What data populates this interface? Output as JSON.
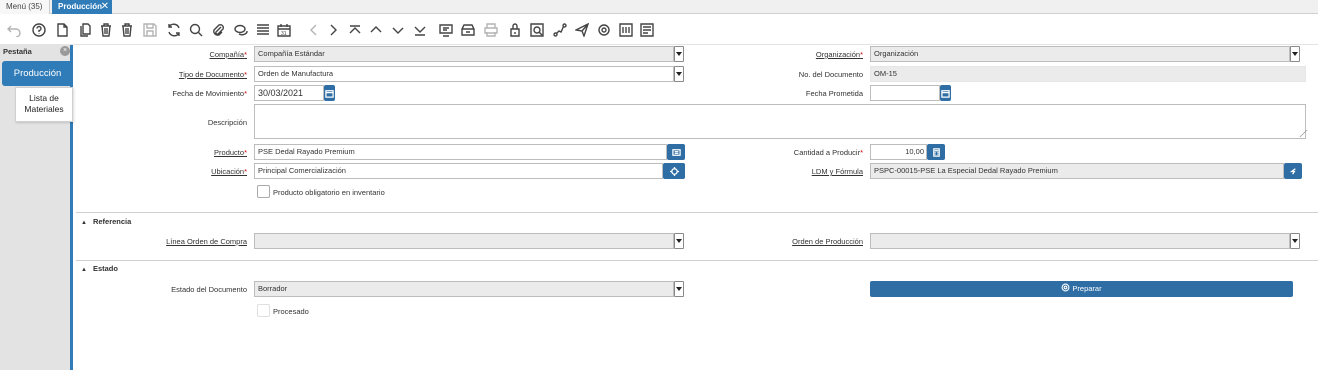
{
  "window_tabs": {
    "menu": "Menú (35)",
    "active": "Producción",
    "close": "✕"
  },
  "left_panel": {
    "title": "Pestaña",
    "items": [
      "Producción",
      "Lista de Materiales"
    ]
  },
  "toolbar_icons": [
    "undo-icon",
    "help-icon",
    "new-record-icon",
    "copy-record-icon",
    "delete-icon",
    "delete-selection-icon",
    "save-icon",
    "refresh-icon",
    "find-icon",
    "attachment-icon",
    "chat-icon",
    "grid-toggle-icon",
    "calendar-icon",
    "previous-record-icon",
    "next-record-icon",
    "first-record-icon",
    "parent-record-icon",
    "detail-record-icon",
    "last-record-icon",
    "report-icon",
    "archive-icon",
    "print-icon",
    "lock-icon",
    "zoom-across-icon",
    "workflow-icon",
    "process-icon",
    "settings-icon",
    "translate-icon",
    "post-icon"
  ],
  "form": {
    "compania": {
      "label": "Compañía",
      "value": "Compañía Estándar"
    },
    "organizacion": {
      "label": "Organización",
      "value": "Organización"
    },
    "tipo_documento": {
      "label": "Tipo de Documento",
      "value": "Orden de Manufactura"
    },
    "no_documento": {
      "label": "No. del Documento",
      "value": "OM-15"
    },
    "fecha_movimiento": {
      "label": "Fecha de Movimiento",
      "value": "30/03/2021"
    },
    "fecha_prometida": {
      "label": "Fecha Prometida",
      "value": ""
    },
    "descripcion": {
      "label": "Descripción",
      "value": ""
    },
    "producto": {
      "label": "Producto",
      "value": "PSE  Dedal Rayado Premium"
    },
    "cantidad": {
      "label": "Cantidad a Producir",
      "value": "10,00"
    },
    "ubicacion": {
      "label": "Ubicación",
      "value": "Principal Comercialización"
    },
    "ldm": {
      "label": "LDM y Fórmula",
      "value": "PSPC-00015-PSE  La Especial Dedal Rayado Premium"
    },
    "producto_obligatorio": {
      "label": "Producto obligatorio en inventario"
    },
    "required_mark": "*"
  },
  "referencia": {
    "title": "Referencia",
    "linea_orden": {
      "label": "Línea Orden de Compra",
      "value": ""
    },
    "orden_produccion": {
      "label": "Orden de Producción",
      "value": ""
    }
  },
  "estado": {
    "title": "Estado",
    "estado_documento": {
      "label": "Estado del Documento",
      "value": "Borrador"
    },
    "preparar_button": "Preparar",
    "procesado": {
      "label": "Procesado"
    }
  },
  "colors": {
    "accent": "#2f7cb8",
    "button": "#2f6ea5",
    "required": "#cc0000"
  }
}
